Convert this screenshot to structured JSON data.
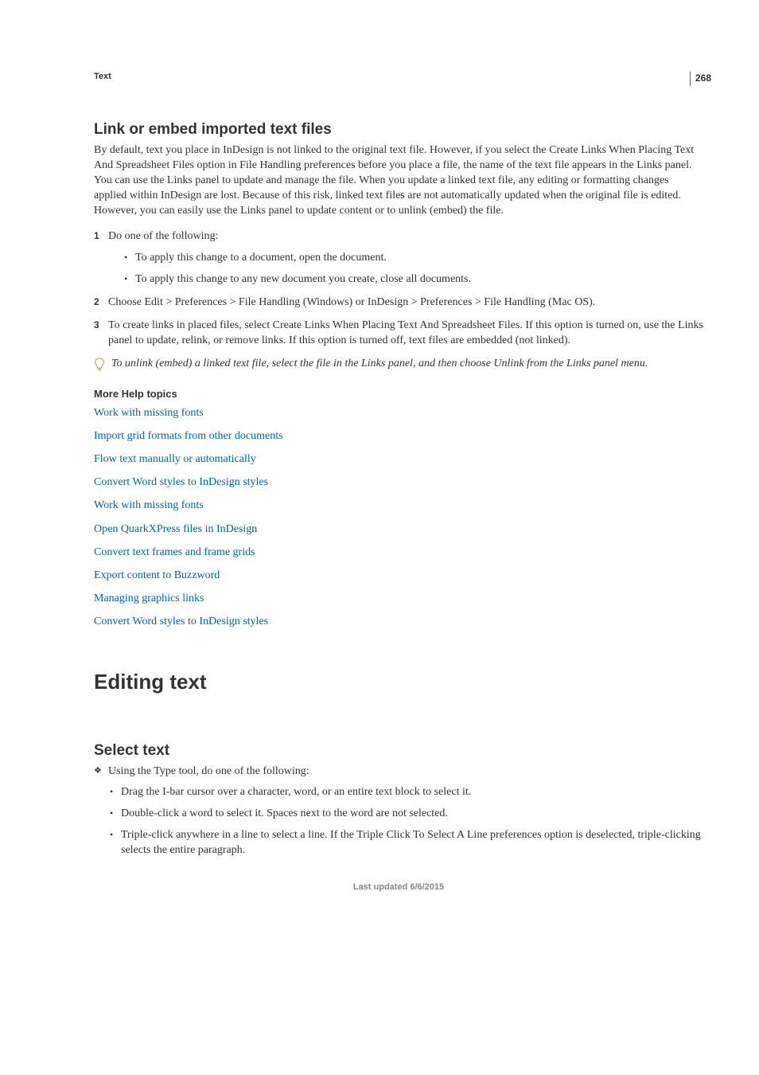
{
  "page_number": "268",
  "breadcrumb": "Text",
  "section1": {
    "heading": "Link or embed imported text files",
    "intro": "By default, text you place in InDesign is not linked to the original text file. However, if you select the Create Links When Placing Text And Spreadsheet Files option in File Handling preferences before you place a file, the name of the text file appears in the Links panel. You can use the Links panel to update and manage the file. When you update a linked text file, any editing or formatting changes applied within InDesign are lost. Because of this risk, linked text files are not automatically updated when the original file is edited. However, you can easily use the Links panel to update content or to unlink (embed) the file.",
    "steps": [
      {
        "num": "1",
        "text": "Do one of the following:",
        "sub": [
          "To apply this change to a document, open the document.",
          "To apply this change to any new document you create, close all documents."
        ]
      },
      {
        "num": "2",
        "text": "Choose Edit > Preferences > File Handling (Windows) or InDesign > Preferences > File Handling (Mac OS)."
      },
      {
        "num": "3",
        "text": "To create links in placed files, select Create Links When Placing Text And Spreadsheet Files. If this option is turned on, use the Links panel to update, relink, or remove links. If this option is turned off, text files are embedded (not linked)."
      }
    ],
    "tip": "To unlink (embed) a linked text file, select the file in the Links panel, and then choose Unlink from the Links panel menu."
  },
  "more_help": {
    "heading": "More Help topics",
    "links": [
      "Work with missing fonts",
      "Import grid formats from other documents",
      "Flow text manually or automatically",
      "Convert Word styles to InDesign styles",
      "Work with missing fonts",
      "Open QuarkXPress files in InDesign",
      "Convert text frames and frame grids",
      "Export content to Buzzword",
      "Managing graphics links",
      "Convert Word styles to InDesign styles"
    ]
  },
  "section2": {
    "title": "Editing text",
    "sub_heading": "Select text",
    "lead": "Using the Type tool, do one of the following:",
    "bullets": [
      "Drag the I-bar cursor over a character, word, or an entire text block to select it.",
      "Double-click a word to select it. Spaces next to the word are not selected.",
      "Triple-click anywhere in a line to select a line. If the Triple Click To Select A Line preferences option is deselected, triple-clicking selects the entire paragraph."
    ]
  },
  "footer": "Last updated 6/6/2015"
}
